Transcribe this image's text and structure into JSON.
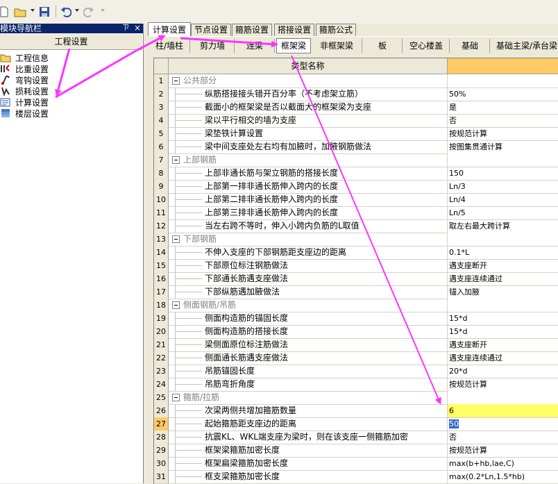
{
  "toolbar": {
    "buttons": [
      {
        "name": "new-document-icon"
      },
      {
        "name": "open-folder-icon"
      },
      {
        "name": "save-icon"
      },
      {
        "name": "undo-icon"
      },
      {
        "name": "redo-icon"
      }
    ]
  },
  "left_panel": {
    "title": "模块导航栏",
    "pin": "ㄗ",
    "close": "×",
    "header": "工程设置",
    "items": [
      {
        "label": "工程信息",
        "icon": "project-info-icon"
      },
      {
        "label": "比重设置",
        "icon": "density-settings-icon"
      },
      {
        "label": "弯钩设置",
        "icon": "hook-settings-icon"
      },
      {
        "label": "损耗设置",
        "icon": "loss-settings-icon"
      },
      {
        "label": "计算设置",
        "icon": "calc-settings-icon"
      },
      {
        "label": "楼层设置",
        "icon": "floor-settings-icon"
      }
    ]
  },
  "tabs_main": [
    "计算设置",
    "节点设置",
    "箍筋设置",
    "搭接设置",
    "箍筋公式"
  ],
  "tabs_sub": [
    "柱/墙柱",
    "剪力墙",
    "连梁",
    "框架梁",
    "非框架梁",
    "板",
    "空心楼盖",
    "基础",
    "基础主梁/承台梁"
  ],
  "grid": {
    "col_header": "类型名称",
    "rows": [
      {
        "n": "1",
        "name": "公共部分",
        "val": "",
        "group": true
      },
      {
        "n": "2",
        "name": "纵筋搭接接头错开百分率（不考虑架立筋）",
        "val": "50%"
      },
      {
        "n": "3",
        "name": "截面小的框架梁是否以截面大的框架梁为支座",
        "val": "是"
      },
      {
        "n": "4",
        "name": "梁以平行相交的墙为支座",
        "val": "否"
      },
      {
        "n": "5",
        "name": "梁垫铁计算设置",
        "val": "按规范计算"
      },
      {
        "n": "6",
        "name": "梁中间支座处左右均有加腋时，加腋钢筋做法",
        "val": "按图集贯通计算"
      },
      {
        "n": "7",
        "name": "上部钢筋",
        "val": "",
        "group": true
      },
      {
        "n": "8",
        "name": "上部非通长筋与架立钢筋的搭接长度",
        "val": "150"
      },
      {
        "n": "9",
        "name": "上部第一排非通长筋伸入跨内的长度",
        "val": "Ln/3"
      },
      {
        "n": "10",
        "name": "上部第二排非通长筋伸入跨内的长度",
        "val": "Ln/4"
      },
      {
        "n": "11",
        "name": "上部第三排非通长筋伸入跨内的长度",
        "val": "Ln/5"
      },
      {
        "n": "12",
        "name": "当左右跨不等时，伸入小跨内负筋的L取值",
        "val": "取左右最大跨计算"
      },
      {
        "n": "13",
        "name": "下部钢筋",
        "val": "",
        "group": true
      },
      {
        "n": "14",
        "name": "不伸入支座的下部钢筋距支座边的距离",
        "val": "0.1*L"
      },
      {
        "n": "15",
        "name": "下部原位标注钢筋做法",
        "val": "遇支座断开"
      },
      {
        "n": "16",
        "name": "下部通长筋遇支座做法",
        "val": "遇支座连续通过"
      },
      {
        "n": "17",
        "name": "下部纵筋遇加腋做法",
        "val": "锚入加腋"
      },
      {
        "n": "18",
        "name": "侧面钢筋/吊筋",
        "val": "",
        "group": true
      },
      {
        "n": "19",
        "name": "侧面构造筋的锚固长度",
        "val": "15*d"
      },
      {
        "n": "20",
        "name": "侧面构造筋的搭接长度",
        "val": "15*d"
      },
      {
        "n": "21",
        "name": "梁侧面原位标注筋做法",
        "val": "遇支座断开"
      },
      {
        "n": "22",
        "name": "侧面通长筋遇支座做法",
        "val": "遇支座连续通过"
      },
      {
        "n": "23",
        "name": "吊筋锚固长度",
        "val": "20*d"
      },
      {
        "n": "24",
        "name": "吊筋弯折角度",
        "val": "按规范计算"
      },
      {
        "n": "25",
        "name": "箍筋/拉筋",
        "val": "",
        "group": true
      },
      {
        "n": "26",
        "name": "次梁两侧共增加箍筋数量",
        "val": "6",
        "hl": true
      },
      {
        "n": "27",
        "name": "起始箍筋距支座边的距离",
        "val": "50",
        "sel": true
      },
      {
        "n": "28",
        "name": "抗震KL、WKL端支座为梁时，则在该支座一侧箍筋加密",
        "val": "否"
      },
      {
        "n": "29",
        "name": "框架梁箍筋加密长度",
        "val": "按规范计算"
      },
      {
        "n": "30",
        "name": "框架扁梁箍筋加密长度",
        "val": "max(b+hb,lae,C)"
      },
      {
        "n": "31",
        "name": "框支梁箍筋加密长度",
        "val": "max(0.2*Ln,1.5*hb)"
      }
    ]
  },
  "colors": {
    "title_bar": "#0a246a",
    "header_accent": "#ffc966",
    "highlight_cell": "#ffff66",
    "selection": "#316ac5",
    "annotation_arrow": "#ff33ff"
  }
}
